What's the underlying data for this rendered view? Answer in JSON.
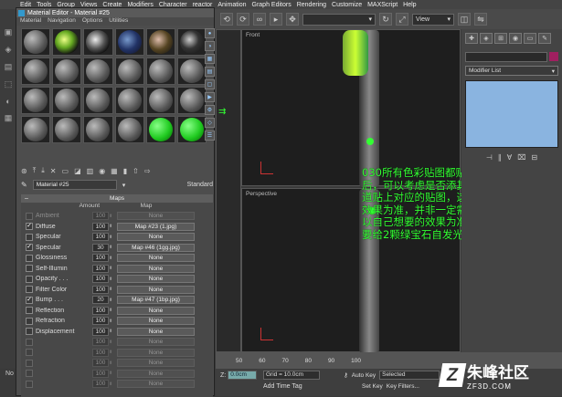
{
  "menubar": [
    "Edit",
    "Tools",
    "Group",
    "Views",
    "Create",
    "Modifiers",
    "Character",
    "reactor",
    "Animation",
    "Graph Editors",
    "Rendering",
    "Customize",
    "MAXScript",
    "Help"
  ],
  "toolbar": {
    "view_dropdown": "View"
  },
  "material_editor": {
    "title": "Material Editor - Material #25",
    "menu": [
      "Material",
      "Navigation",
      "Options",
      "Utilities"
    ],
    "material_name": "Material #25",
    "material_type": "Standard",
    "maps_section": {
      "header": "Maps",
      "col_amount": "Amount",
      "col_map": "Map",
      "rows": [
        {
          "label": "Ambient",
          "checked": false,
          "amount": "100",
          "map": "None",
          "dim": true
        },
        {
          "label": "Diffuse",
          "checked": true,
          "amount": "100",
          "map": "Map #23 (1.jpg)",
          "dim": false
        },
        {
          "label": "Specular",
          "checked": false,
          "amount": "100",
          "map": "None",
          "dim": false
        },
        {
          "label": "Specular",
          "checked": true,
          "amount": "30",
          "map": "Map #46 (1gg.jpg)",
          "dim": false
        },
        {
          "label": "Glossiness",
          "checked": false,
          "amount": "100",
          "map": "None",
          "dim": false
        },
        {
          "label": "Self-Illumin",
          "checked": false,
          "amount": "100",
          "map": "None",
          "dim": false
        },
        {
          "label": "Opacity . . .",
          "checked": false,
          "amount": "100",
          "map": "None",
          "dim": false
        },
        {
          "label": "Filter Color",
          "checked": false,
          "amount": "100",
          "map": "None",
          "dim": false
        },
        {
          "label": "Bump . . .",
          "checked": true,
          "amount": "20",
          "map": "Map #47 (1bp.jpg)",
          "dim": false
        },
        {
          "label": "Reflection",
          "checked": false,
          "amount": "100",
          "map": "None",
          "dim": false
        },
        {
          "label": "Refraction",
          "checked": false,
          "amount": "100",
          "map": "None",
          "dim": false
        },
        {
          "label": "Displacement",
          "checked": false,
          "amount": "100",
          "map": "None",
          "dim": false
        },
        {
          "label": "",
          "checked": false,
          "amount": "100",
          "map": "None",
          "dim": true
        },
        {
          "label": "",
          "checked": false,
          "amount": "100",
          "map": "None",
          "dim": true
        },
        {
          "label": "",
          "checked": false,
          "amount": "100",
          "map": "None",
          "dim": true
        },
        {
          "label": "",
          "checked": false,
          "amount": "100",
          "map": "None",
          "dim": true
        },
        {
          "label": "",
          "checked": false,
          "amount": "100",
          "map": "None",
          "dim": true
        }
      ]
    }
  },
  "viewports": {
    "front": "Front",
    "perspective": "Perspective"
  },
  "annotation": "030所有色彩贴图都贴上以后，可以考虑是否添其他通道贴上对应的贴图，这个以效果为准，并非一定需要，以自己想要的效果为准，还要给2颗绿宝石自发光。",
  "command_panel": {
    "modifier_list": "Modifier List"
  },
  "timeline": {
    "ticks": [
      "50",
      "60",
      "70",
      "80",
      "90",
      "100"
    ]
  },
  "status": {
    "z_label": "Z:",
    "z_value": "0.0cm",
    "grid": "Grid = 10.0cm",
    "auto_key": "Auto Key",
    "selected": "Selected",
    "set_key": "Set Key",
    "key_filters": "Key Filters...",
    "add_time_tag": "Add Time Tag"
  },
  "watermark": {
    "cn": "朱峰社区",
    "en": "ZF3D.COM"
  },
  "left_bottom": "No"
}
